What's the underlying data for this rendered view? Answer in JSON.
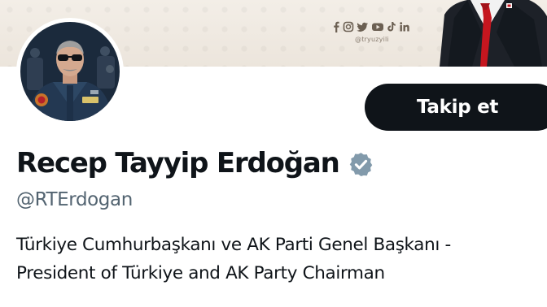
{
  "banner": {
    "social_icons": [
      "facebook-icon",
      "instagram-icon",
      "twitter-icon",
      "youtube-icon",
      "tiktok-icon",
      "linkedin-icon"
    ],
    "watermark_handle": "@tryuzyili",
    "tint_color": "#ede6dd"
  },
  "profile": {
    "display_name": "Recep Tayyip Erdoğan",
    "username": "@RTErdogan",
    "verified_badge": "verified-gray-icon",
    "verified_color": "#829aab",
    "bio_lines": [
      "Türkiye Cumhurbaşkanı ve AK Parti Genel Başkanı -",
      "President of Türkiye and AK Party Chairman"
    ]
  },
  "actions": {
    "follow_label": "Takip et"
  },
  "colors": {
    "text_primary": "#0f1419",
    "text_secondary": "#536471",
    "button_bg": "#0f1419"
  }
}
